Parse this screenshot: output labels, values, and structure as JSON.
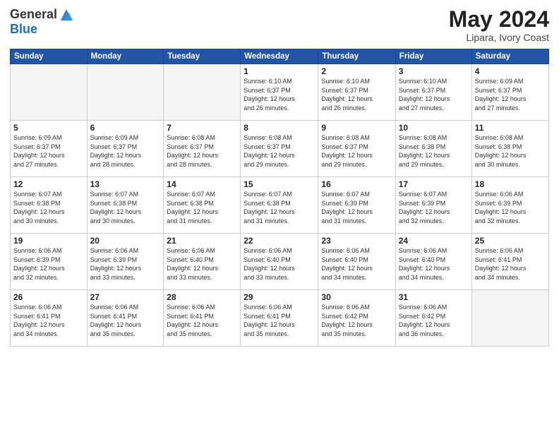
{
  "header": {
    "logo_general": "General",
    "logo_blue": "Blue",
    "title": "May 2024",
    "location": "Lipara, Ivory Coast"
  },
  "weekdays": [
    "Sunday",
    "Monday",
    "Tuesday",
    "Wednesday",
    "Thursday",
    "Friday",
    "Saturday"
  ],
  "weeks": [
    [
      {
        "day": "",
        "info": ""
      },
      {
        "day": "",
        "info": ""
      },
      {
        "day": "",
        "info": ""
      },
      {
        "day": "1",
        "info": "Sunrise: 6:10 AM\nSunset: 6:37 PM\nDaylight: 12 hours\nand 26 minutes."
      },
      {
        "day": "2",
        "info": "Sunrise: 6:10 AM\nSunset: 6:37 PM\nDaylight: 12 hours\nand 26 minutes."
      },
      {
        "day": "3",
        "info": "Sunrise: 6:10 AM\nSunset: 6:37 PM\nDaylight: 12 hours\nand 27 minutes."
      },
      {
        "day": "4",
        "info": "Sunrise: 6:09 AM\nSunset: 6:37 PM\nDaylight: 12 hours\nand 27 minutes."
      }
    ],
    [
      {
        "day": "5",
        "info": "Sunrise: 6:09 AM\nSunset: 6:37 PM\nDaylight: 12 hours\nand 27 minutes."
      },
      {
        "day": "6",
        "info": "Sunrise: 6:09 AM\nSunset: 6:37 PM\nDaylight: 12 hours\nand 28 minutes."
      },
      {
        "day": "7",
        "info": "Sunrise: 6:08 AM\nSunset: 6:37 PM\nDaylight: 12 hours\nand 28 minutes."
      },
      {
        "day": "8",
        "info": "Sunrise: 6:08 AM\nSunset: 6:37 PM\nDaylight: 12 hours\nand 29 minutes."
      },
      {
        "day": "9",
        "info": "Sunrise: 6:08 AM\nSunset: 6:37 PM\nDaylight: 12 hours\nand 29 minutes."
      },
      {
        "day": "10",
        "info": "Sunrise: 6:08 AM\nSunset: 6:38 PM\nDaylight: 12 hours\nand 29 minutes."
      },
      {
        "day": "11",
        "info": "Sunrise: 6:08 AM\nSunset: 6:38 PM\nDaylight: 12 hours\nand 30 minutes."
      }
    ],
    [
      {
        "day": "12",
        "info": "Sunrise: 6:07 AM\nSunset: 6:38 PM\nDaylight: 12 hours\nand 30 minutes."
      },
      {
        "day": "13",
        "info": "Sunrise: 6:07 AM\nSunset: 6:38 PM\nDaylight: 12 hours\nand 30 minutes."
      },
      {
        "day": "14",
        "info": "Sunrise: 6:07 AM\nSunset: 6:38 PM\nDaylight: 12 hours\nand 31 minutes."
      },
      {
        "day": "15",
        "info": "Sunrise: 6:07 AM\nSunset: 6:38 PM\nDaylight: 12 hours\nand 31 minutes."
      },
      {
        "day": "16",
        "info": "Sunrise: 6:07 AM\nSunset: 6:39 PM\nDaylight: 12 hours\nand 31 minutes."
      },
      {
        "day": "17",
        "info": "Sunrise: 6:07 AM\nSunset: 6:39 PM\nDaylight: 12 hours\nand 32 minutes."
      },
      {
        "day": "18",
        "info": "Sunrise: 6:06 AM\nSunset: 6:39 PM\nDaylight: 12 hours\nand 32 minutes."
      }
    ],
    [
      {
        "day": "19",
        "info": "Sunrise: 6:06 AM\nSunset: 6:39 PM\nDaylight: 12 hours\nand 32 minutes."
      },
      {
        "day": "20",
        "info": "Sunrise: 6:06 AM\nSunset: 6:39 PM\nDaylight: 12 hours\nand 33 minutes."
      },
      {
        "day": "21",
        "info": "Sunrise: 6:06 AM\nSunset: 6:40 PM\nDaylight: 12 hours\nand 33 minutes."
      },
      {
        "day": "22",
        "info": "Sunrise: 6:06 AM\nSunset: 6:40 PM\nDaylight: 12 hours\nand 33 minutes."
      },
      {
        "day": "23",
        "info": "Sunrise: 6:06 AM\nSunset: 6:40 PM\nDaylight: 12 hours\nand 34 minutes."
      },
      {
        "day": "24",
        "info": "Sunrise: 6:06 AM\nSunset: 6:40 PM\nDaylight: 12 hours\nand 34 minutes."
      },
      {
        "day": "25",
        "info": "Sunrise: 6:06 AM\nSunset: 6:41 PM\nDaylight: 12 hours\nand 34 minutes."
      }
    ],
    [
      {
        "day": "26",
        "info": "Sunrise: 6:06 AM\nSunset: 6:41 PM\nDaylight: 12 hours\nand 34 minutes."
      },
      {
        "day": "27",
        "info": "Sunrise: 6:06 AM\nSunset: 6:41 PM\nDaylight: 12 hours\nand 35 minutes."
      },
      {
        "day": "28",
        "info": "Sunrise: 6:06 AM\nSunset: 6:41 PM\nDaylight: 12 hours\nand 35 minutes."
      },
      {
        "day": "29",
        "info": "Sunrise: 6:06 AM\nSunset: 6:41 PM\nDaylight: 12 hours\nand 35 minutes."
      },
      {
        "day": "30",
        "info": "Sunrise: 6:06 AM\nSunset: 6:42 PM\nDaylight: 12 hours\nand 35 minutes."
      },
      {
        "day": "31",
        "info": "Sunrise: 6:06 AM\nSunset: 6:42 PM\nDaylight: 12 hours\nand 36 minutes."
      },
      {
        "day": "",
        "info": ""
      }
    ]
  ]
}
